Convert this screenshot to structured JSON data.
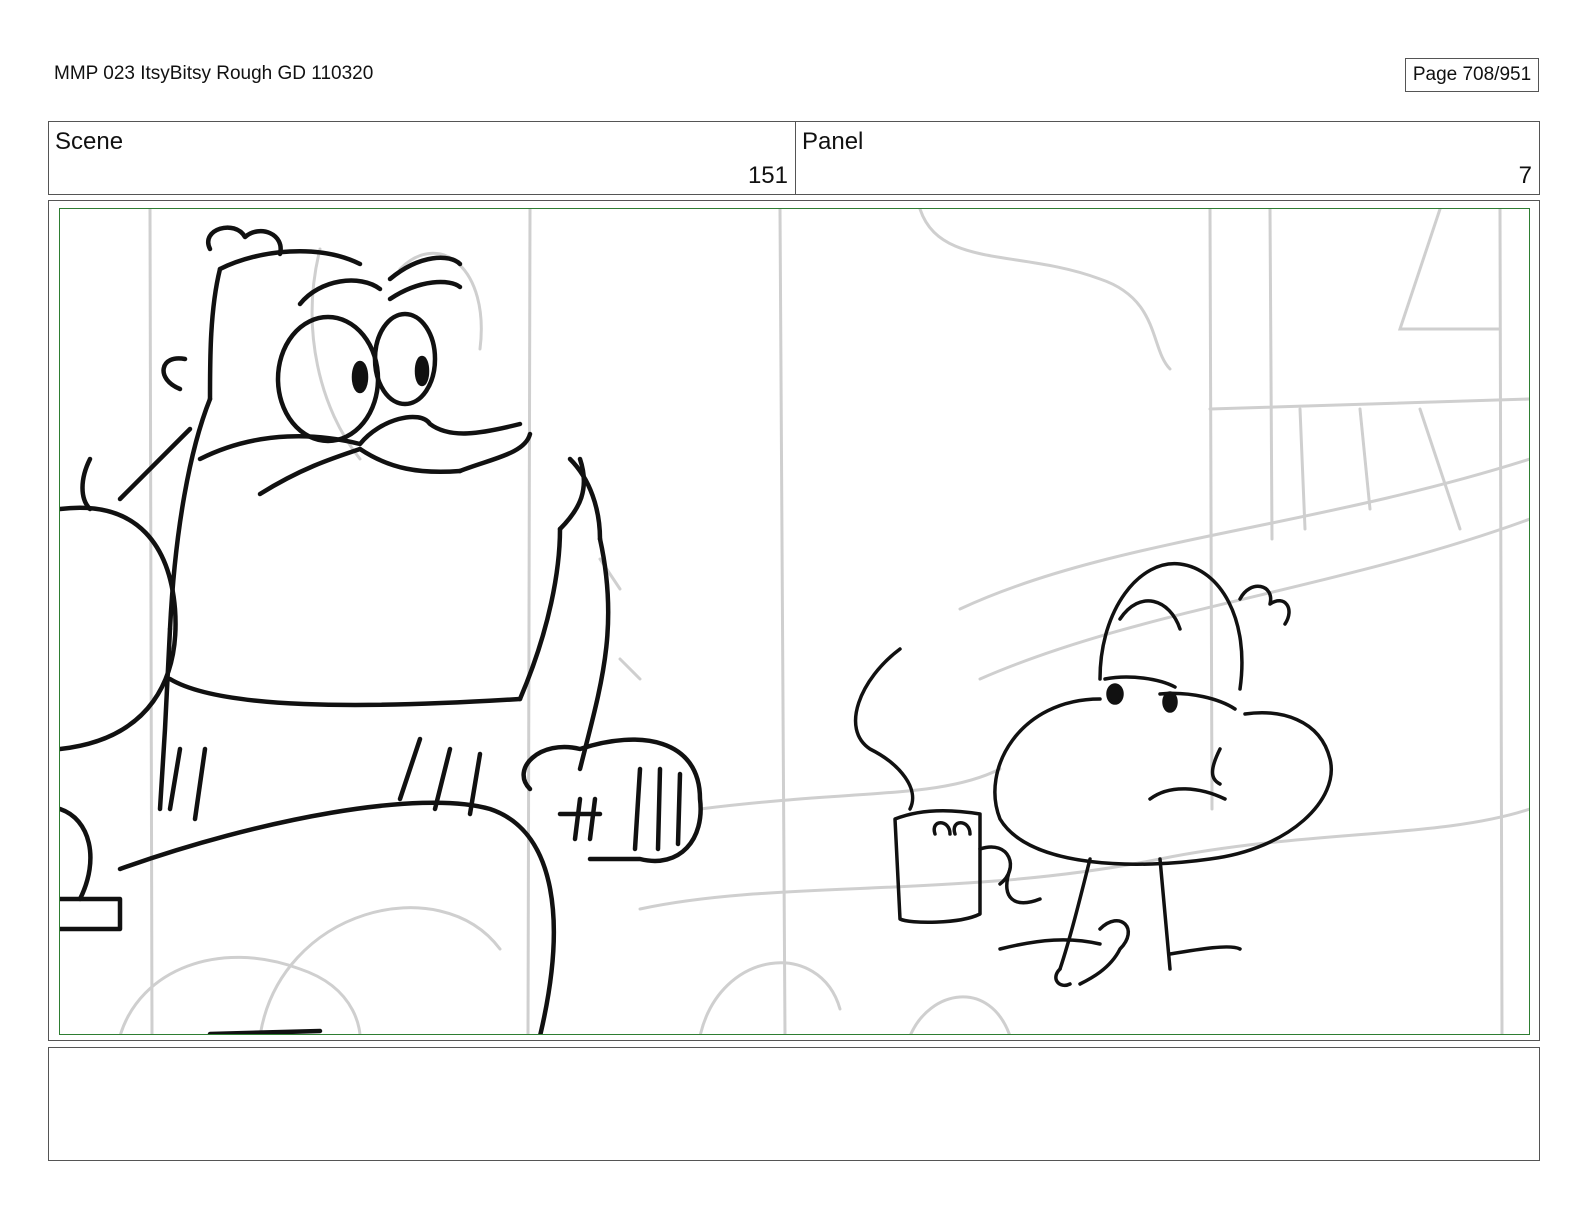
{
  "header": {
    "document_title": "MMP 023 ItsyBitsy Rough GD 110320",
    "page_label": "Page 708/951"
  },
  "info": {
    "scene_label": "Scene",
    "scene_number": "151",
    "panel_label": "Panel",
    "panel_number": "7"
  },
  "frame": {
    "border_color": "#2e7d32",
    "sketch_color": "#111111",
    "background_line_color": "#cfcfcf"
  },
  "notes": {
    "text": ""
  }
}
